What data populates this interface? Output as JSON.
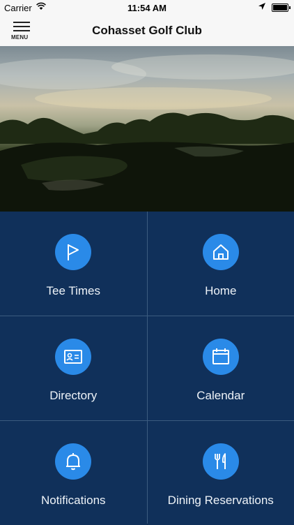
{
  "status": {
    "carrier": "Carrier",
    "time": "11:54 AM"
  },
  "nav": {
    "title": "Cohasset Golf Club",
    "menu_label": "MENU"
  },
  "tiles": [
    {
      "label": "Tee Times",
      "icon": "flag-icon"
    },
    {
      "label": "Home",
      "icon": "home-icon"
    },
    {
      "label": "Directory",
      "icon": "id-card-icon"
    },
    {
      "label": "Calendar",
      "icon": "calendar-icon"
    },
    {
      "label": "Notifications",
      "icon": "bell-icon"
    },
    {
      "label": "Dining Reservations",
      "icon": "fork-knife-icon"
    }
  ],
  "colors": {
    "accent": "#2a8ae8",
    "tile_bg": "#10305a",
    "grid_line": "#3c5c80"
  }
}
